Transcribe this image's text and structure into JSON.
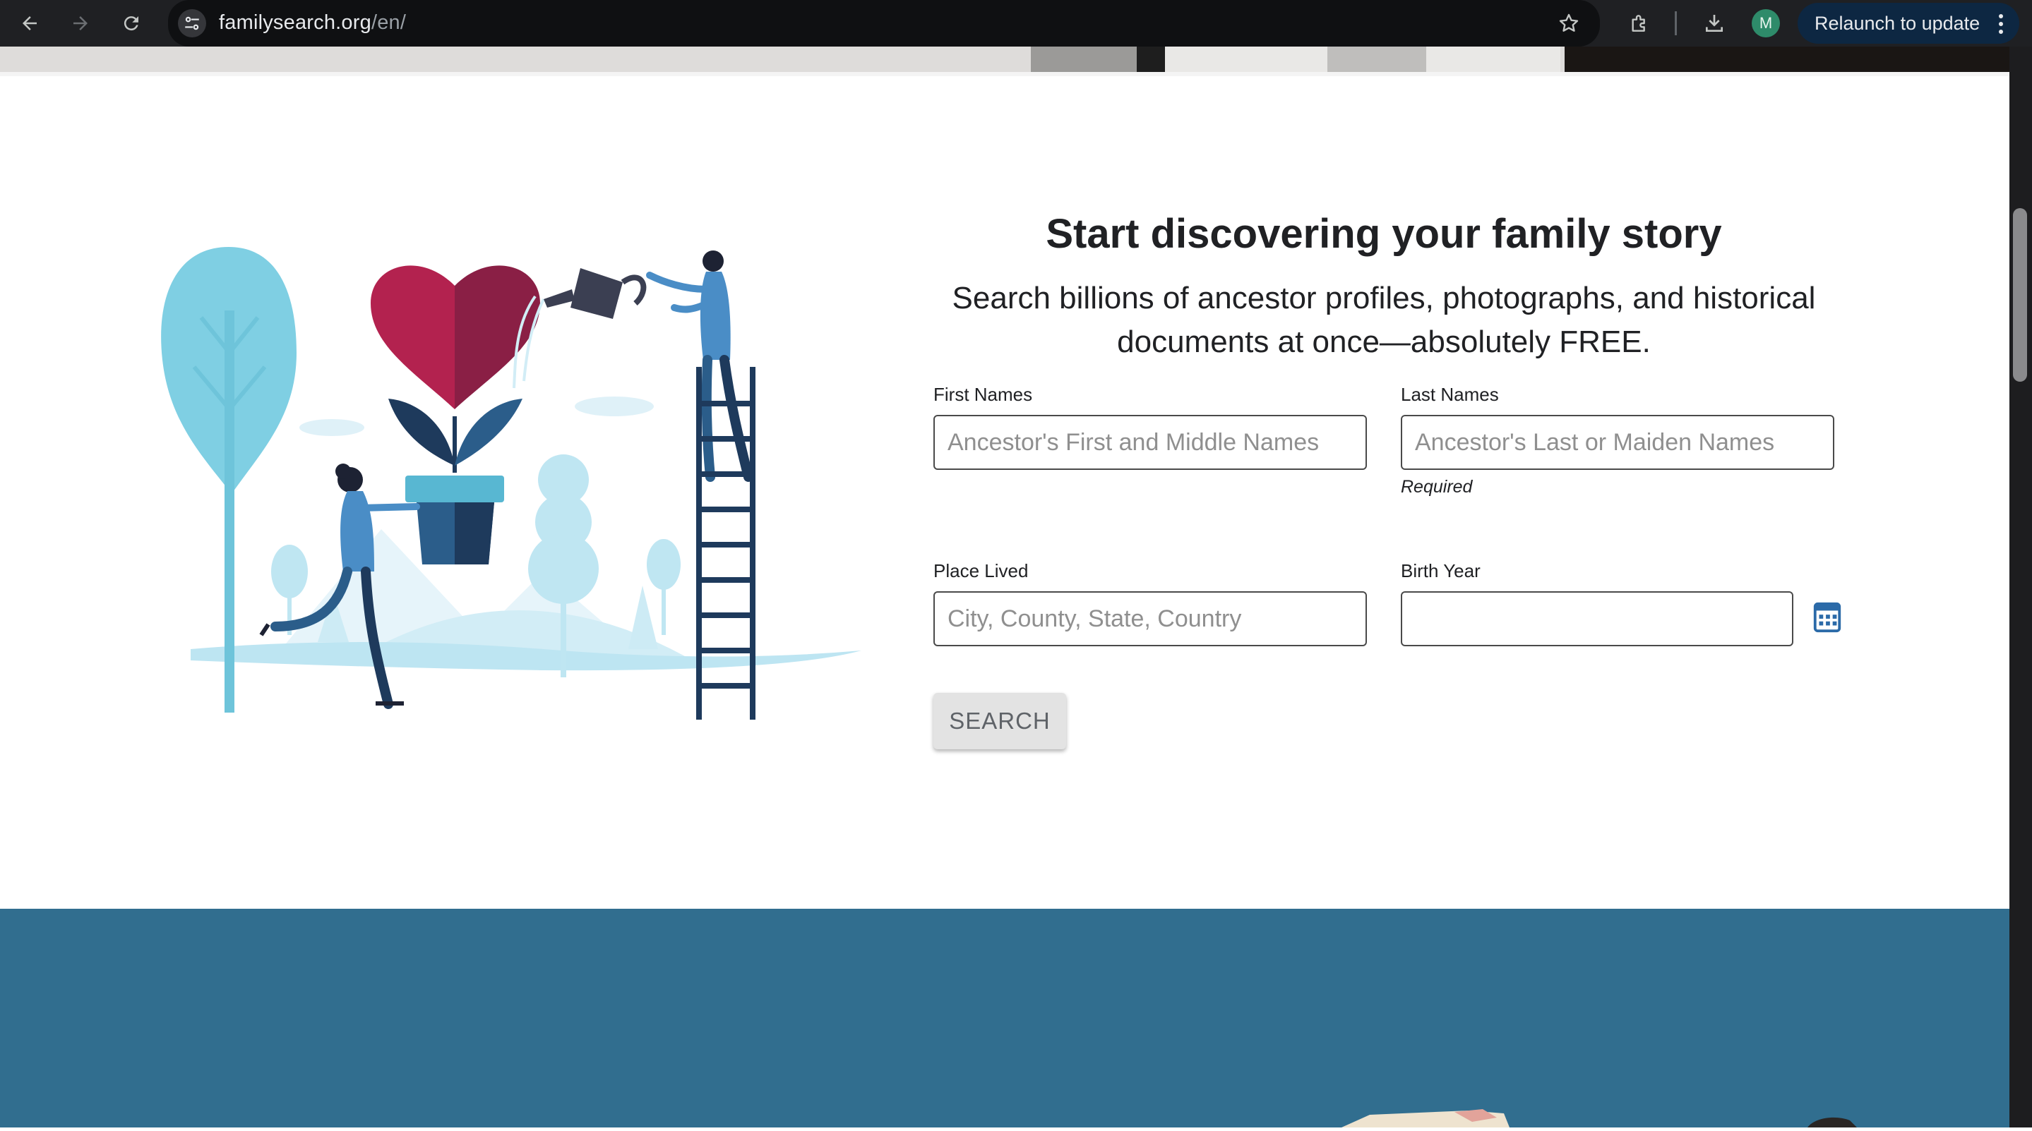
{
  "browser": {
    "url_host": "familysearch.org",
    "url_path": "/en/",
    "profile_initial": "M",
    "relaunch_label": "Relaunch to update"
  },
  "icons": [
    "back-arrow-icon",
    "forward-arrow-icon",
    "reload-icon",
    "site-info-icon",
    "star-icon",
    "extensions-icon",
    "download-icon",
    "more-icon",
    "calendar-icon"
  ],
  "search_section": {
    "headline": "Start discovering your family story",
    "subtitle_line1": "Search billions of ancestor profiles, photographs, and historical",
    "subtitle_line2": "documents at once—absolutely FREE.",
    "fields": {
      "first_names": {
        "label": "First Names",
        "placeholder": "Ancestor's First and Middle Names",
        "value": ""
      },
      "last_names": {
        "label": "Last Names",
        "placeholder": "Ancestor's Last or Maiden Names",
        "value": "",
        "hint": "Required"
      },
      "place_lived": {
        "label": "Place Lived",
        "placeholder": "City, County, State, Country",
        "value": ""
      },
      "birth_year": {
        "label": "Birth Year",
        "placeholder": "",
        "value": ""
      }
    },
    "search_button": "SEARCH"
  },
  "colors": {
    "heart_left": "#b3224f",
    "heart_right": "#8a1f45",
    "light_blue": "#7fcfe3",
    "navy": "#1e3a5c",
    "band": "#316e8f"
  }
}
